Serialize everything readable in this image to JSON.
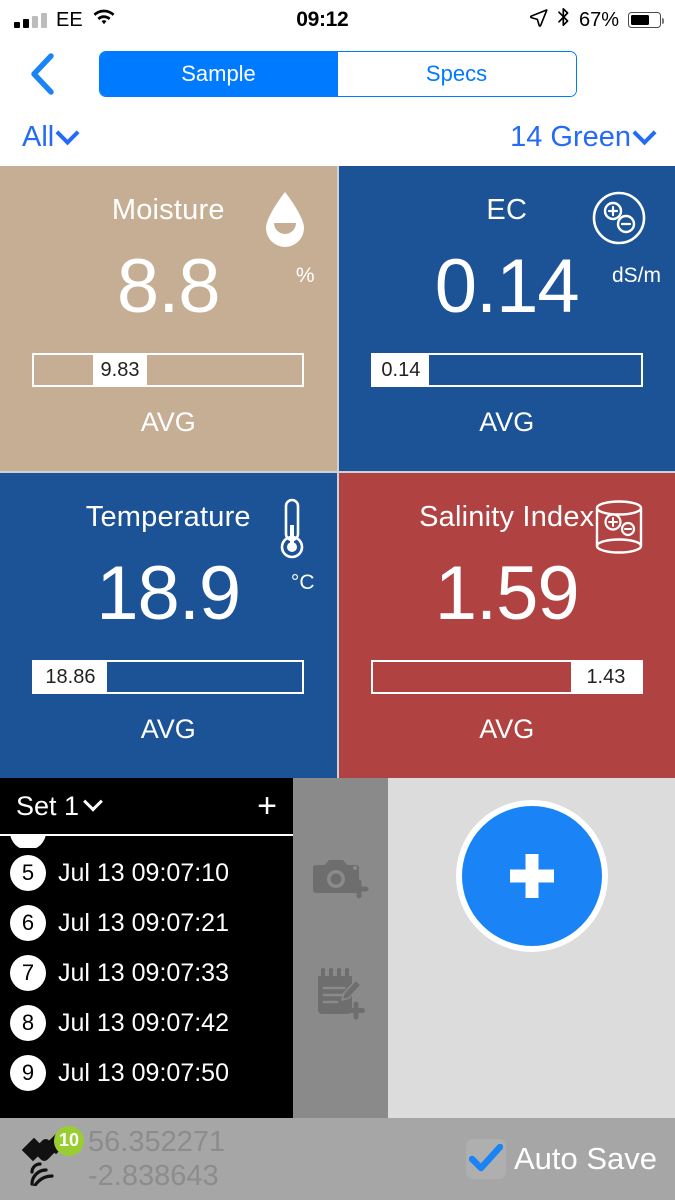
{
  "status_bar": {
    "carrier": "EE",
    "time": "09:12",
    "battery_percent": "67%",
    "signal_icon": "signal-bars-icon",
    "wifi_icon": "wifi-icon",
    "location_icon": "location-arrow-icon",
    "bluetooth_icon": "bluetooth-icon",
    "battery_icon": "battery-icon",
    "battery_level": 67
  },
  "nav": {
    "back_icon": "back-chevron-icon",
    "segments": [
      {
        "label": "Sample",
        "selected": true
      },
      {
        "label": "Specs",
        "selected": false
      }
    ]
  },
  "filters": {
    "left": "All",
    "right": "14 Green",
    "chevron_icon": "chevron-down-icon"
  },
  "cards": [
    {
      "title": "Moisture",
      "value": "8.8",
      "unit": "%",
      "avg_label": "AVG",
      "avg_value": "9.83",
      "icon": "water-drop-icon",
      "bg": "#c6ae94",
      "bar_before_pct": 22,
      "bar_mark_pct": 20
    },
    {
      "title": "EC",
      "value": "0.14",
      "unit": "dS/m",
      "avg_label": "AVG",
      "avg_value": "0.14",
      "icon": "ion-circle-icon",
      "bg": "#1c5296",
      "bar_before_pct": 0,
      "bar_mark_pct": 21
    },
    {
      "title": "Temperature",
      "value": "18.9",
      "unit": "°C",
      "avg_label": "AVG",
      "avg_value": "18.86",
      "icon": "thermometer-icon",
      "bg": "#1c5296",
      "bar_before_pct": 0,
      "bar_mark_pct": 27
    },
    {
      "title": "Salinity Index",
      "value": "1.59",
      "unit": "",
      "avg_label": "AVG",
      "avg_value": "1.43",
      "icon": "beaker-ions-icon",
      "bg": "#b04242",
      "bar_before_pct": 74,
      "bar_mark_pct": 26
    }
  ],
  "sample_list": {
    "set_label": "Set 1",
    "set_chevron_icon": "chevron-down-icon",
    "add_icon": "plus-icon",
    "items": [
      {
        "index": "5",
        "timestamp": "Jul 13 09:07:10"
      },
      {
        "index": "6",
        "timestamp": "Jul 13 09:07:21"
      },
      {
        "index": "7",
        "timestamp": "Jul 13 09:07:33"
      },
      {
        "index": "8",
        "timestamp": "Jul 13 09:07:42"
      },
      {
        "index": "9",
        "timestamp": "Jul 13 09:07:50"
      }
    ]
  },
  "tools": {
    "add_photo_icon": "camera-plus-icon",
    "add_note_icon": "note-plus-icon",
    "fab_icon": "plus-icon",
    "fab_color": "#1a84f7"
  },
  "footer": {
    "gps_icon": "satellite-icon",
    "satellite_count": "10",
    "latitude": "56.352271",
    "longitude": "-2.838643",
    "auto_save_label": "Auto Save",
    "auto_save_checked": true,
    "check_icon": "check-icon",
    "accent_color": "#1a84f7",
    "badge_color": "#9acd32"
  }
}
